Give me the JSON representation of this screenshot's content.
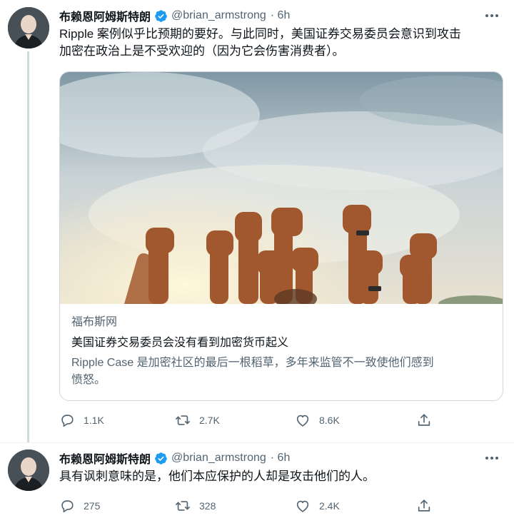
{
  "tweets": [
    {
      "author_name": "布赖恩阿姆斯特朗",
      "handle": "@brian_armstrong",
      "time": "· 6h",
      "text_line1": "Ripple 案例似乎比预期的要好。与此同时，美国证券交易委员会意识到攻击",
      "text_line2": "加密在政治上是不受欢迎的（因为它会伤害消费者）。",
      "card": {
        "domain": "福布斯网",
        "title": "美国证券交易委员会没有看到加密货币起义",
        "desc_line1": "Ripple Case 是加密社区的最后一根稻草，多年来监管不一致使他们感到",
        "desc_line2": "愤怒。"
      },
      "replies": "1.1K",
      "retweets": "2.7K",
      "likes": "8.6K"
    },
    {
      "author_name": "布赖恩阿姆斯特朗",
      "handle": "@brian_armstrong",
      "time": "· 6h",
      "text_line1": "具有讽刺意味的是，他们本应保护的人却是攻击他们的人。",
      "replies": "275",
      "retweets": "328",
      "likes": "2.4K"
    }
  ],
  "icons": {
    "verified": "verified-badge-icon",
    "more": "more-horizontal-icon",
    "reply": "reply-icon",
    "retweet": "retweet-icon",
    "like": "heart-icon",
    "share": "share-icon"
  },
  "colors": {
    "verified_blue": "#1d9bf0",
    "secondary_text": "#536471",
    "border": "#cfd9de"
  }
}
